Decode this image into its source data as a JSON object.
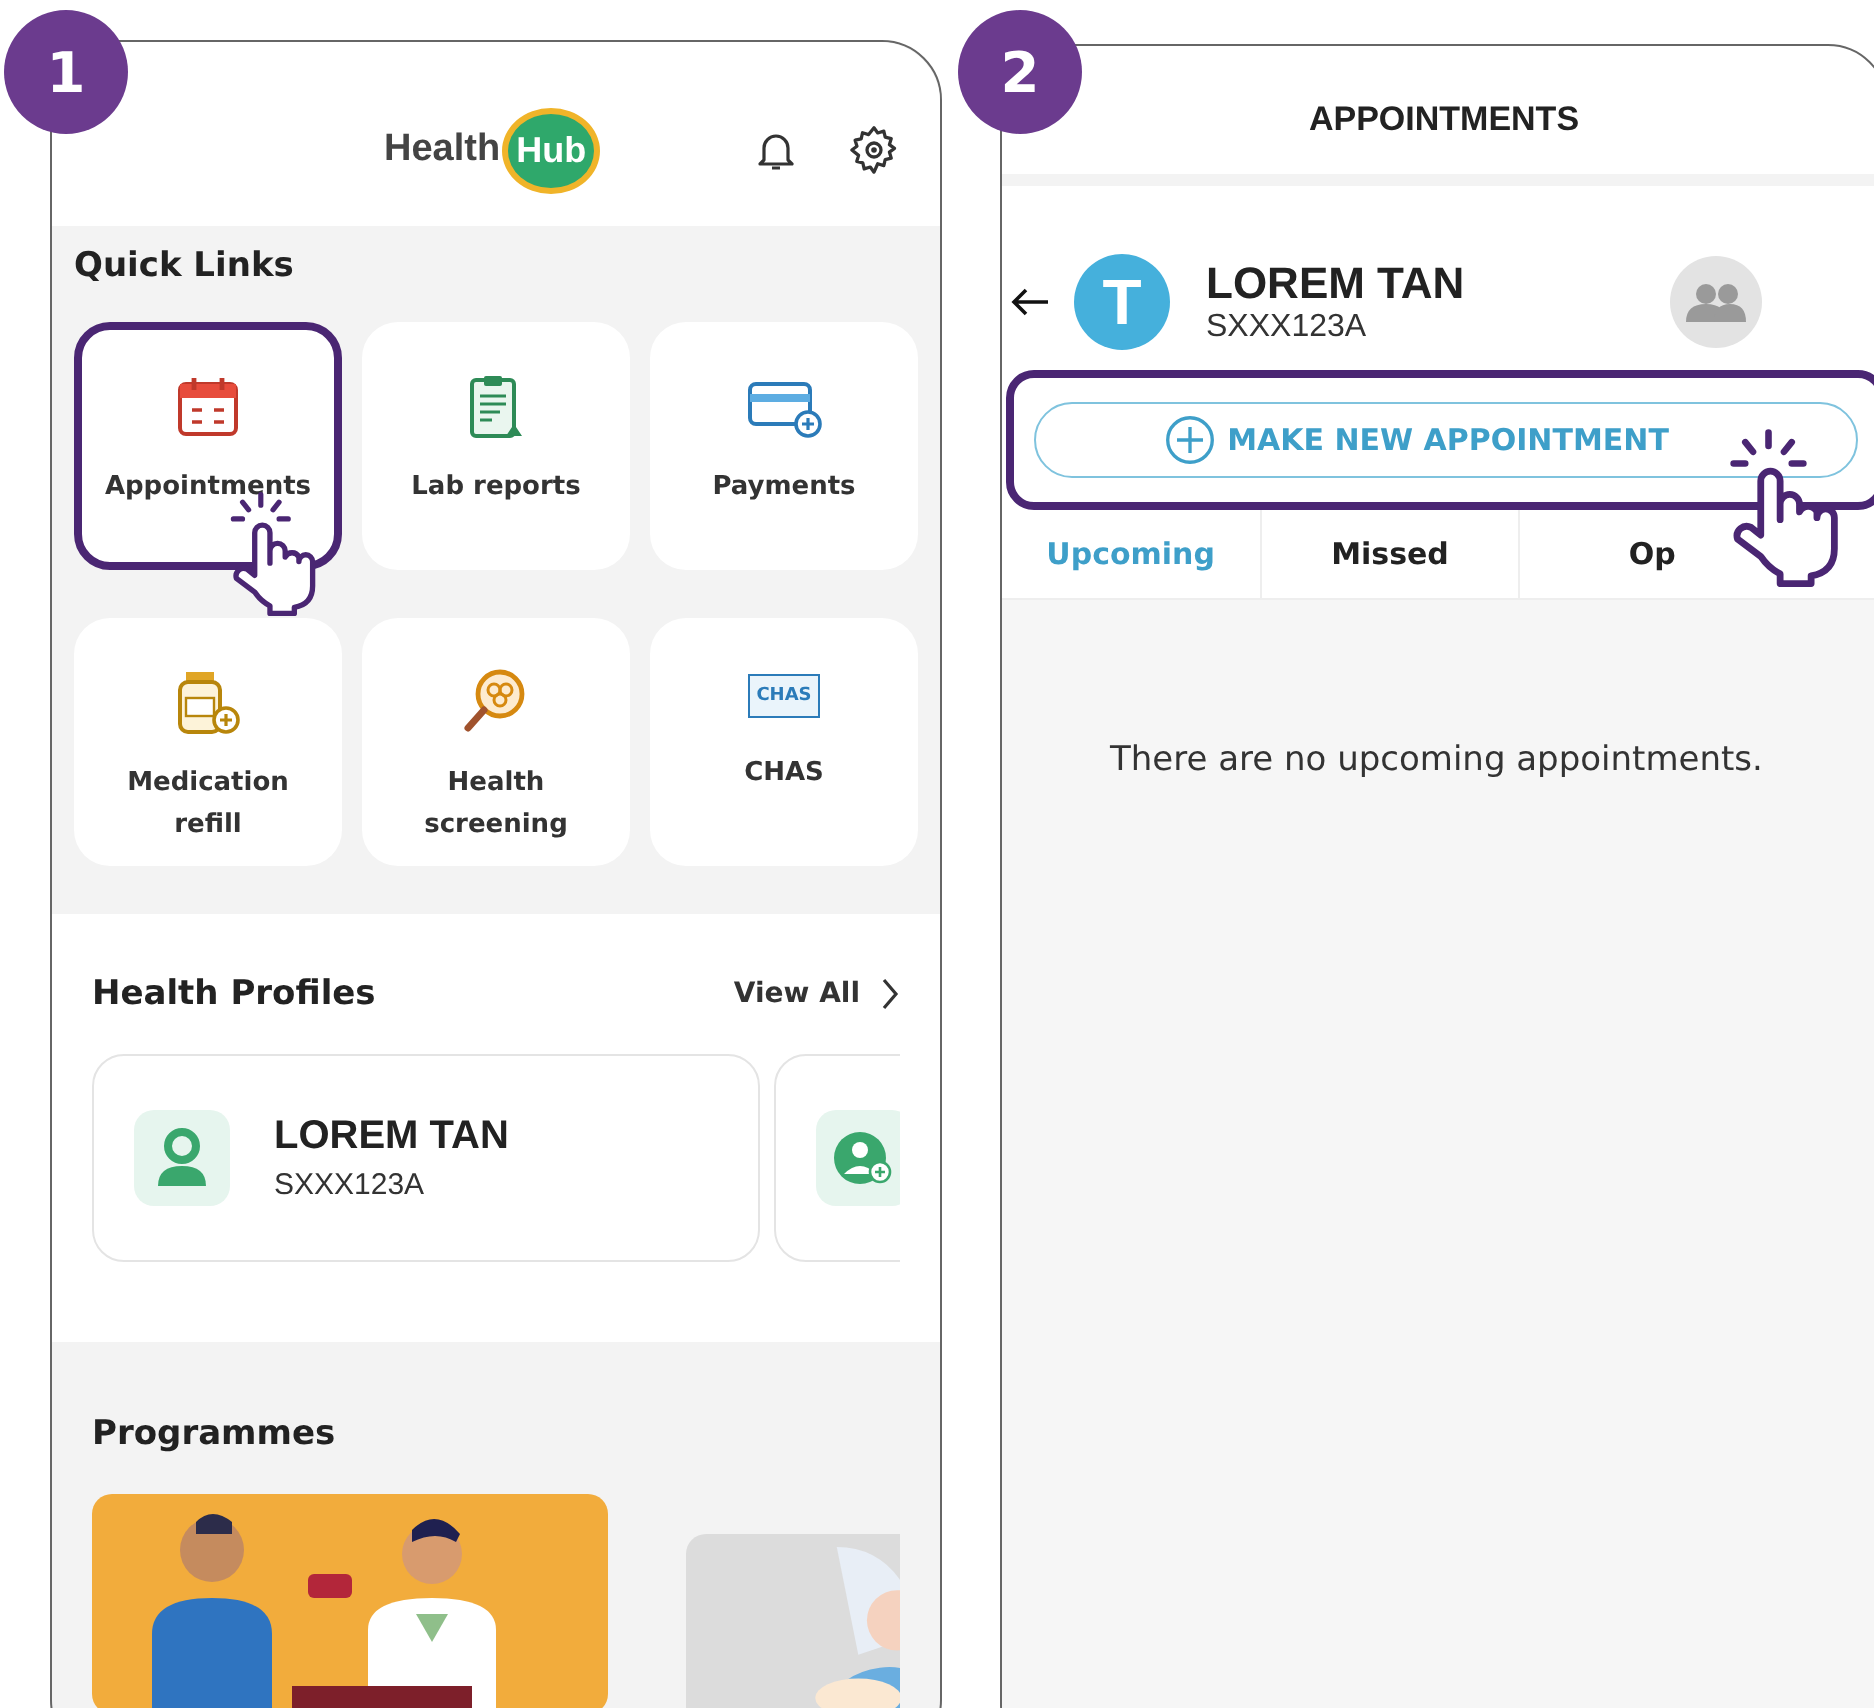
{
  "home_screen": {
    "badge": "1",
    "logo": {
      "text": "Health",
      "highlight": "Hub"
    },
    "quick_links": {
      "title": "Quick Links",
      "items": [
        {
          "label": "Appointments",
          "kind": "calendar",
          "highlighted": true
        },
        {
          "label": "Lab reports",
          "kind": "clipboard",
          "highlighted": false
        },
        {
          "label": "Payments",
          "kind": "card",
          "highlighted": false
        },
        {
          "label": "Medication refill",
          "kind": "jar",
          "highlighted": false
        },
        {
          "label": "Health screening",
          "kind": "magnifier",
          "highlighted": false
        },
        {
          "label": "CHAS",
          "kind": "tag",
          "tag_text": "CHAS",
          "highlighted": false
        }
      ]
    },
    "health_profiles": {
      "title": "Health Profiles",
      "view_all": "View All",
      "profiles": [
        {
          "name": "LOREM TAN",
          "id": "SXXX123A"
        }
      ]
    },
    "programmes": {
      "title": "Programmes"
    }
  },
  "appointments_screen": {
    "badge": "2",
    "title": "APPOINTMENTS",
    "profile": {
      "initial": "T",
      "name": "LOREM TAN",
      "id": "SXXX123A"
    },
    "button": {
      "label": "MAKE NEW APPOINTMENT",
      "highlighted": true
    },
    "tabs": [
      {
        "label": "Upcoming",
        "selected": true
      },
      {
        "label": "Missed",
        "selected": false
      },
      {
        "label": "Op",
        "selected": false
      }
    ],
    "empty_message": "There are no upcoming appointments."
  }
}
